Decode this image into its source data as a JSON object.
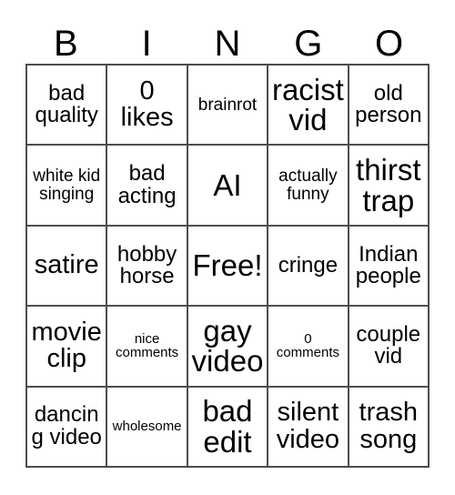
{
  "card": {
    "header_letters": [
      "B",
      "I",
      "N",
      "G",
      "O"
    ],
    "free_space_label": "Free!",
    "border_color": "#4d4d4d",
    "background_color": "#ffffff",
    "text_color": "#000000",
    "rows": [
      [
        {
          "text": "bad quality",
          "size": "md"
        },
        {
          "text": "0 likes",
          "size": "lg"
        },
        {
          "text": "brainrot",
          "size": "sm"
        },
        {
          "text": "racist vid",
          "size": "xl"
        },
        {
          "text": "old person",
          "size": "md"
        }
      ],
      [
        {
          "text": "white kid singing",
          "size": "sm"
        },
        {
          "text": "bad acting",
          "size": "md"
        },
        {
          "text": "AI",
          "size": "xl"
        },
        {
          "text": "actually funny",
          "size": "sm"
        },
        {
          "text": "thirst trap",
          "size": "xl"
        }
      ],
      [
        {
          "text": "satire",
          "size": "lg"
        },
        {
          "text": "hobby horse",
          "size": "md"
        },
        {
          "text": "Free!",
          "size": "xl"
        },
        {
          "text": "cringe",
          "size": "md"
        },
        {
          "text": "Indian people",
          "size": "md"
        }
      ],
      [
        {
          "text": "movie clip",
          "size": "lg"
        },
        {
          "text": "nice comments",
          "size": "xs"
        },
        {
          "text": "gay video",
          "size": "xl"
        },
        {
          "text": "0 comments",
          "size": "xs"
        },
        {
          "text": "couple vid",
          "size": "md"
        }
      ],
      [
        {
          "text": "dancing video",
          "size": "md"
        },
        {
          "text": "wholesome",
          "size": "xs"
        },
        {
          "text": "bad edit",
          "size": "xl"
        },
        {
          "text": "silent video",
          "size": "lg"
        },
        {
          "text": "trash song",
          "size": "lg"
        }
      ]
    ]
  }
}
